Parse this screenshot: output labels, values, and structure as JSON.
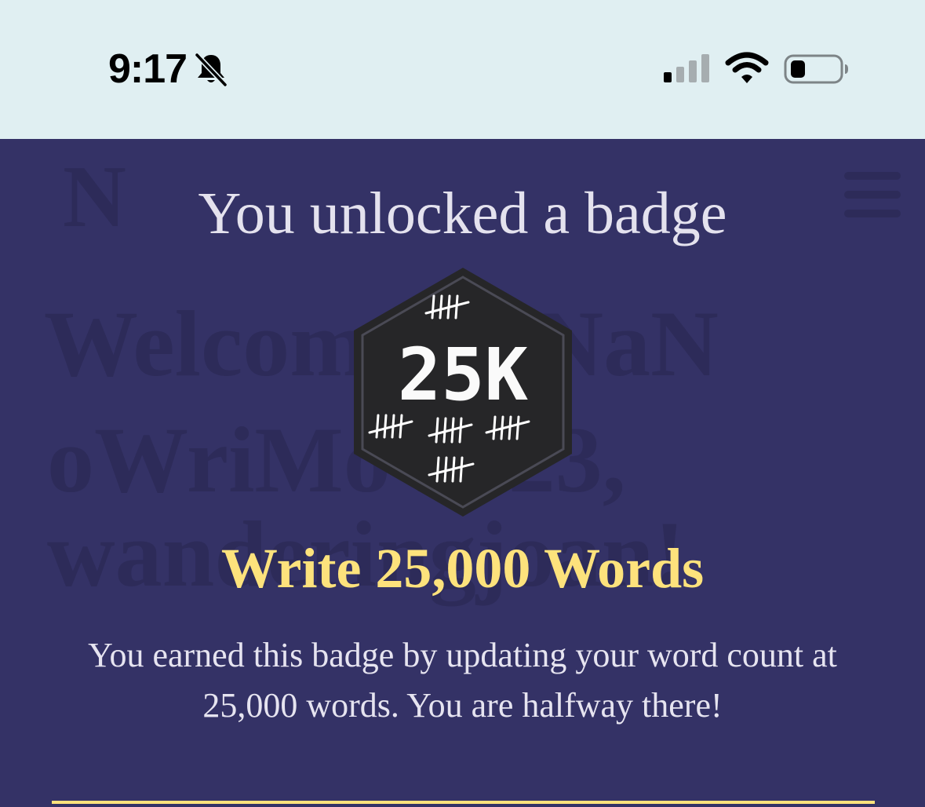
{
  "status_bar": {
    "time": "9:17",
    "icons": [
      "bell-slash-icon",
      "cellular-signal-icon",
      "wifi-icon",
      "battery-icon"
    ]
  },
  "background": {
    "logo_letter": "N",
    "headline_lines": [
      "Welcome to NaN",
      "oWriMo 2023,",
      "wanderingjoan!"
    ]
  },
  "modal": {
    "title": "You unlocked a badge",
    "badge_label": "25K",
    "badge_name": "Write 25,000 Words",
    "description": "You earned this badge by updating your word count at 25,000 words. You are halfway there!"
  },
  "colors": {
    "status_bar_bg": "#e0eff2",
    "overlay_bg": "#343266",
    "accent_yellow": "#fde27c",
    "badge_bg": "#262628"
  }
}
